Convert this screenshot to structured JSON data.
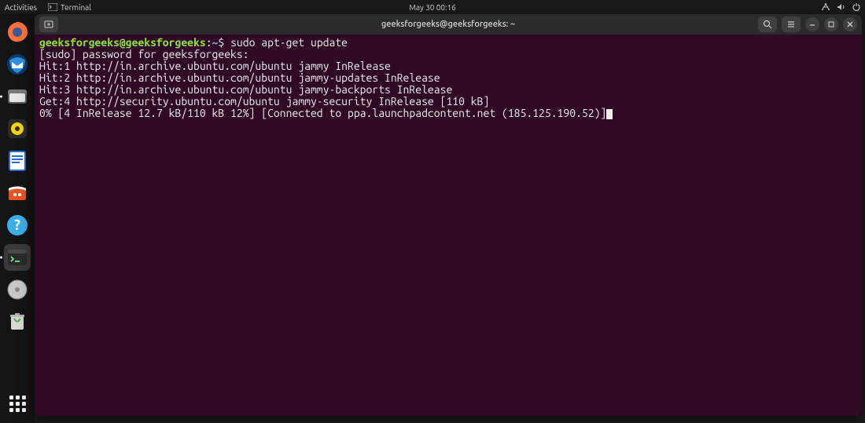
{
  "topbar": {
    "activities": "Activities",
    "terminal_label": "Terminal",
    "datetime": "May 30  00:16"
  },
  "dock": {
    "items": [
      {
        "name": "firefox-icon"
      },
      {
        "name": "thunderbird-icon"
      },
      {
        "name": "files-icon"
      },
      {
        "name": "rhythmbox-icon"
      },
      {
        "name": "libreoffice-writer-icon"
      },
      {
        "name": "software-icon"
      },
      {
        "name": "help-icon"
      },
      {
        "name": "terminal-icon"
      },
      {
        "name": "disk-icon"
      },
      {
        "name": "trash-icon"
      }
    ]
  },
  "window": {
    "title": "geeksforgeeks@geeksforgeeks: ~"
  },
  "terminal": {
    "prompt_user": "geeksforgeeks@geeksforgeeks",
    "prompt_sep": ":",
    "prompt_path": "~",
    "prompt_symbol": "$ ",
    "command": "sudo apt-get update",
    "lines": [
      "[sudo] password for geeksforgeeks: ",
      "Hit:1 http://in.archive.ubuntu.com/ubuntu jammy InRelease",
      "Hit:2 http://in.archive.ubuntu.com/ubuntu jammy-updates InRelease",
      "Hit:3 http://in.archive.ubuntu.com/ubuntu jammy-backports InRelease",
      "Get:4 http://security.ubuntu.com/ubuntu jammy-security InRelease [110 kB]",
      "0% [4 InRelease 12.7 kB/110 kB 12%] [Connected to ppa.launchpadcontent.net (185.125.190.52)]"
    ]
  }
}
